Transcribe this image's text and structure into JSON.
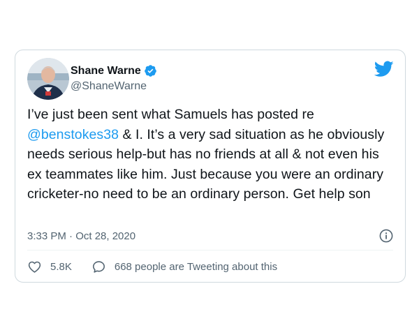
{
  "tweet": {
    "author_name": "Shane Warne",
    "author_handle": "@ShaneWarne",
    "text_before_mention": "I’ve just been sent what Samuels has posted re ",
    "mention": "@benstokes38",
    "text_after_mention": " & I. It’s a very sad situation as he obviously needs serious help-but has no friends at all & not even his ex teammates like him. Just because you were an ordinary cricketer-no need to be an ordinary person. Get help son",
    "timestamp": "3:33 PM · Oct 28, 2020",
    "likes": "5.8K",
    "replies_text": "668 people are Tweeting about this"
  },
  "icons": {
    "verified": "verified-badge-icon",
    "brand": "twitter-bird-icon",
    "info": "info-icon",
    "like": "heart-icon",
    "reply": "speech-bubble-icon"
  },
  "colors": {
    "accent": "#1d9bf0",
    "text": "#0f1419",
    "secondary": "#536471",
    "border": "#cfd9de"
  }
}
